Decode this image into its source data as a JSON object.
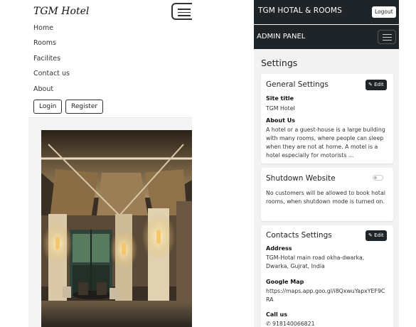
{
  "site": {
    "brand": "TGM Hotel",
    "nav": [
      "Home",
      "Rooms",
      "Facilites",
      "Contact us",
      "About"
    ],
    "login_label": "Login",
    "register_label": "Register"
  },
  "admin": {
    "topbar_title": "TGM HOTAL & ROOMS",
    "logout_label": "Logout",
    "panel_title": "ADMIN PANEL",
    "page_title": "Settings",
    "edit_label": "Edit",
    "general": {
      "title": "General Settings",
      "site_title_label": "Site title",
      "site_title_value": "TGM Hotel",
      "about_label": "About Us",
      "about_value": "A hotel or a guest-house is a large building with many rooms, where people can sleep when they are not at home. A motel is a hotel especially for motorists ..."
    },
    "shutdown": {
      "title": "Shutdown Website",
      "enabled": false,
      "description": "No customers will be allowed to book hotal rooms, when shutdown mode is turned on."
    },
    "contacts": {
      "title": "Contacts Settings",
      "address_label": "Address",
      "address_value": "TGM-Hotal main road okha-dwarka, Dwarka, Gujrat, India",
      "map_label": "Google Map",
      "map_value": "https://maps.app.goo.gl/i8QxwuYapxYEF9CRA",
      "call_label": "Call us",
      "phone": "918140066821"
    }
  },
  "colors": {
    "dark": "#1f2428",
    "panel_bg": "#f2f2f2"
  }
}
